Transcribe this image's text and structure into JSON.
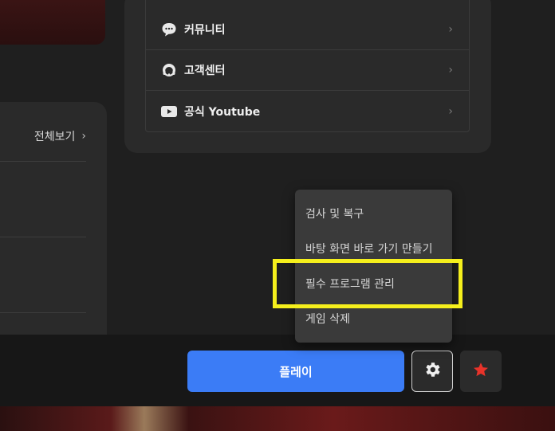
{
  "community_links": [
    {
      "label": "커뮤니티",
      "icon": "chat-bubble-icon"
    },
    {
      "label": "고객센터",
      "icon": "headset-icon"
    },
    {
      "label": "공식 Youtube",
      "icon": "youtube-icon"
    }
  ],
  "news": {
    "view_all": "전체보기"
  },
  "context_menu": {
    "items": [
      {
        "label": "검사 및 복구"
      },
      {
        "label": "바탕 화면 바로 가기 만들기"
      },
      {
        "label": "필수 프로그램 관리",
        "highlighted": true
      },
      {
        "label": "게임 삭제"
      }
    ]
  },
  "actions": {
    "play_label": "플레이",
    "settings_icon": "gear-icon",
    "favorite_icon": "star-icon"
  },
  "colors": {
    "play": "#3b7cf6",
    "highlight": "#f5ef1c",
    "favorite": "#e8332a"
  }
}
